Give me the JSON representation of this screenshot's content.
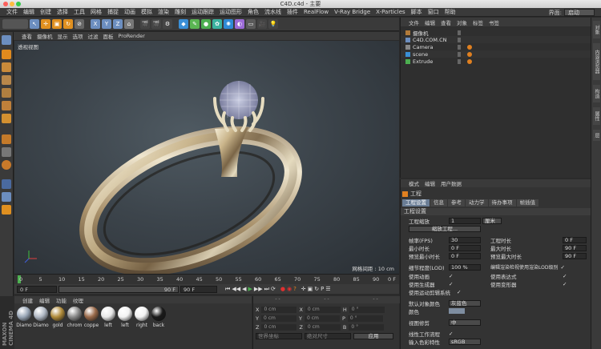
{
  "window": {
    "title": "C4D.c4d - 主要"
  },
  "menubar": {
    "items": [
      "文件",
      "编辑",
      "创建",
      "选择",
      "工具",
      "网格",
      "捕捉",
      "动画",
      "模拟",
      "渲染",
      "雕刻",
      "运动跟踪",
      "运动图形",
      "角色",
      "流水线",
      "插件",
      "RealFlow",
      "V-Ray Bridge",
      "X-Particles",
      "脚本",
      "窗口",
      "帮助"
    ],
    "interface_label": "界面:",
    "interface_value": "启动"
  },
  "viewport": {
    "menu": [
      "查看",
      "摄像机",
      "显示",
      "选项",
      "过滤",
      "面板",
      "ProRender"
    ],
    "title": "透视视图",
    "grid_spacing": "网格间距 : 10 cm"
  },
  "timeline": {
    "ticks": [
      "0",
      "5",
      "10",
      "15",
      "20",
      "25",
      "30",
      "35",
      "40",
      "45",
      "50",
      "55",
      "60",
      "65",
      "70",
      "75",
      "80",
      "85",
      "90"
    ],
    "frame_end_marker": "0 F",
    "current_frame": "0 F",
    "start": "0 F",
    "end_a": "90 F",
    "end_b": "90 F"
  },
  "materials": {
    "menu": [
      "创建",
      "编辑",
      "功能",
      "纹理"
    ],
    "items": [
      {
        "name": "Diamo",
        "color": "#9aa7b7"
      },
      {
        "name": "Diamo",
        "color": "#b0b8c4"
      },
      {
        "name": "gold",
        "color": "#b08b3a"
      },
      {
        "name": "chrom",
        "color": "#8a8a8a"
      },
      {
        "name": "coppe",
        "color": "#9a6a4a"
      },
      {
        "name": "left",
        "color": "#e8e8e8"
      },
      {
        "name": "left",
        "color": "#f2f2f2"
      },
      {
        "name": "right",
        "color": "#f2f2f2"
      },
      {
        "name": "back",
        "color": "#1a1a1a"
      }
    ]
  },
  "coords": {
    "rows": [
      {
        "a": "X",
        "av": "0 cm",
        "b": "X",
        "bv": "0 cm",
        "c": "H",
        "cv": "0 °"
      },
      {
        "a": "Y",
        "av": "0 cm",
        "b": "Y",
        "bv": "0 cm",
        "c": "P",
        "cv": "0 °"
      },
      {
        "a": "Z",
        "av": "0 cm",
        "b": "Z",
        "bv": "0 cm",
        "c": "B",
        "cv": "0 °"
      }
    ],
    "mode1": "世界坐标",
    "mode2": "绝对尺寸",
    "apply": "应用"
  },
  "objects": {
    "menu": [
      "文件",
      "编辑",
      "查看",
      "对象",
      "标签",
      "书签"
    ],
    "items": [
      {
        "name": "摄像机",
        "indent": 6
      },
      {
        "name": "C4D.COM.CN",
        "indent": 6
      },
      {
        "name": "Camera",
        "indent": 6
      },
      {
        "name": "scene",
        "indent": 6
      },
      {
        "name": "Extrude",
        "indent": 6
      }
    ]
  },
  "attributes": {
    "menu": [
      "模式",
      "编辑",
      "用户数据"
    ],
    "heading": "工程",
    "tabs": [
      "工程设置",
      "信息",
      "参考",
      "动力学",
      "待办事项",
      "帧插值"
    ],
    "section": "工程设置",
    "scale_label": "工程缩放",
    "scale_value": "1",
    "scale_unit": "厘米",
    "scale_button": "缩放工程...",
    "fps_label": "帧率(FPS)",
    "fps_value": "30",
    "duration_label": "工程时长",
    "duration_value": "0 F",
    "min_label": "最小时长",
    "min_value": "0 F",
    "max_label": "最大时长",
    "max_value": "90 F",
    "pmin_label": "预览最小时长",
    "pmin_value": "0 F",
    "pmax_label": "预览最大时长",
    "pmax_value": "90 F",
    "lod_label": "细节程度(LOD)",
    "lod_value": "100 %",
    "lod_render": "编辑渲染检视使用渲染LOD级别",
    "anim": "使用动画",
    "expr": "使用表达式",
    "gen": "使用生成器",
    "deform": "使用变形器",
    "motion": "使用运动剪辑系统",
    "color_label": "默认对象颜色",
    "color_value": "灰蓝色",
    "color2": "颜色",
    "clip_label": "视图修剪",
    "clip_value": "中",
    "linear": "线性工作流程",
    "input": "输入色彩特性",
    "input_value": "sRGB"
  },
  "rightstrip": [
    "对象",
    "内容浏览器",
    "构造",
    "属性",
    "层"
  ],
  "logo": "MAXON CINEMA 4D"
}
